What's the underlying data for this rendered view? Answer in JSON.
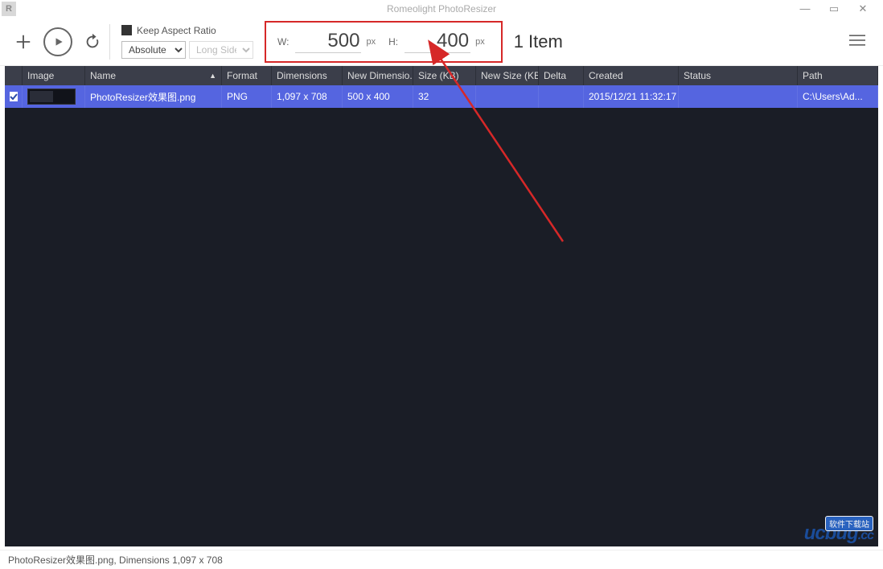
{
  "window": {
    "title": "Romeolight PhotoResizer",
    "app_icon_letter": "R"
  },
  "toolbar": {
    "keep_aspect_label": "Keep Aspect Ratio",
    "mode_select": "Absolute",
    "side_select": "Long Side",
    "width_label": "W:",
    "width_value": "500",
    "width_unit": "px",
    "height_label": "H:",
    "height_value": "400",
    "height_unit": "px",
    "item_count": "1 Item"
  },
  "table": {
    "headers": {
      "image": "Image",
      "name": "Name",
      "format": "Format",
      "dimensions": "Dimensions",
      "new_dimensions": "New Dimensio...",
      "size": "Size (KB)",
      "new_size": "New Size (KB)",
      "delta": "Delta",
      "created": "Created",
      "status": "Status",
      "path": "Path"
    },
    "rows": [
      {
        "name": "PhotoResizer效果图.png",
        "format": "PNG",
        "dimensions": "1,097 x 708",
        "new_dimensions": "500 x 400",
        "size": "32",
        "new_size": "",
        "delta": "",
        "created": "2015/12/21 11:32:17",
        "status": "",
        "path": "C:\\Users\\Ad..."
      }
    ]
  },
  "statusbar": {
    "text": "PhotoResizer效果图.png, Dimensions 1,097 x 708"
  },
  "watermark": {
    "sub": "软件下载站",
    "brand": "ucbug",
    "tld": ".cc"
  }
}
